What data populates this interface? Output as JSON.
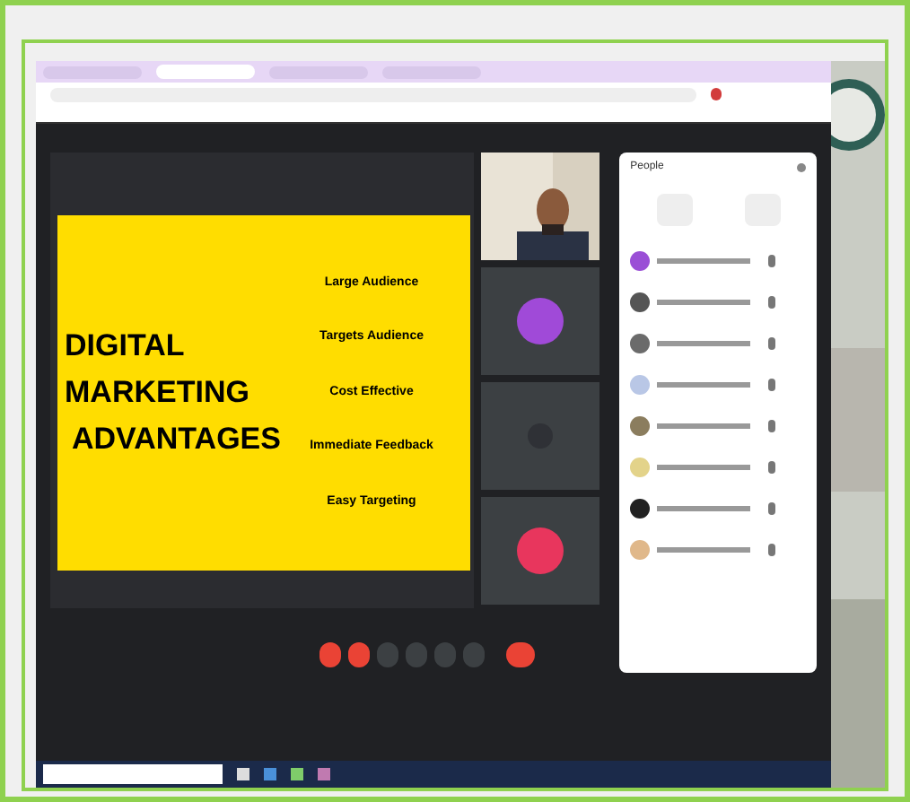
{
  "browser_tabs": [
    {
      "selected": false
    },
    {
      "selected": true
    },
    {
      "selected": false
    },
    {
      "selected": false
    }
  ],
  "slide": {
    "title_lines": [
      "DIGITAL",
      "MARKETING",
      "ADVANTAGES"
    ],
    "points": [
      "Large Audience",
      "Targets Audience",
      "Cost Effective",
      "Immediate Feedback",
      "Easy Targeting"
    ]
  },
  "tiles": [
    {
      "kind": "video"
    },
    {
      "kind": "avatar",
      "color": "#a04ad8"
    },
    {
      "kind": "muted",
      "color": "#2f3136"
    },
    {
      "kind": "avatar",
      "color": "#e8365d"
    }
  ],
  "people_panel": {
    "title": "People",
    "participants": [
      {
        "color": "#9a4fd6"
      },
      {
        "color": "#555555"
      },
      {
        "color": "#6b6b6b"
      },
      {
        "color": "#b9c7e6"
      },
      {
        "color": "#8b7d5e"
      },
      {
        "color": "#e3d38a"
      },
      {
        "color": "#222222"
      },
      {
        "color": "#e0b88a"
      }
    ]
  },
  "controls": [
    {
      "color": "#ea4335"
    },
    {
      "color": "#ea4335"
    },
    {
      "color": "#3c4043"
    },
    {
      "color": "#3c4043"
    },
    {
      "color": "#3c4043"
    },
    {
      "color": "#3c4043"
    },
    {
      "color": "#ea4335"
    }
  ]
}
